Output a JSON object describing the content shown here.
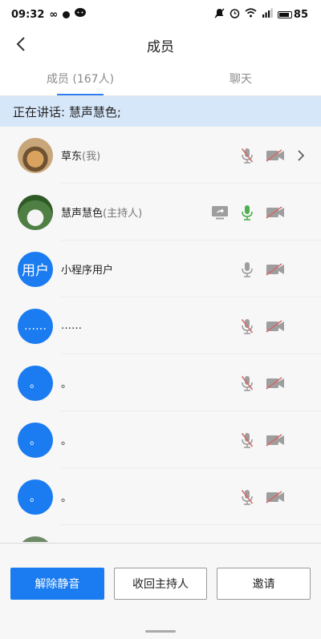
{
  "status_bar": {
    "time": "09:32",
    "infinity": "∞",
    "battery": "85"
  },
  "header": {
    "title": "成员"
  },
  "tabs": [
    {
      "label": "成员 (167人)",
      "active": true
    },
    {
      "label": "聊天",
      "active": false
    }
  ],
  "speaking": {
    "text": "正在讲话: 慧声慧色;"
  },
  "members": [
    {
      "avatar_text": "",
      "avatar_style": "photo1",
      "name": "草东",
      "role": "(我)",
      "share": false,
      "mic": "muted",
      "cam": "off",
      "chevron": true
    },
    {
      "avatar_text": "",
      "avatar_style": "photo2",
      "name": "慧声慧色",
      "role": "(主持人)",
      "share": true,
      "mic": "active",
      "cam": "off",
      "chevron": false
    },
    {
      "avatar_text": "用户",
      "avatar_style": "blue",
      "name": "小程序用户",
      "role": "",
      "share": false,
      "mic": "normal",
      "cam": "off",
      "chevron": false
    },
    {
      "avatar_text": "……",
      "avatar_style": "blue",
      "name": "……",
      "role": "",
      "share": false,
      "mic": "muted",
      "cam": "off",
      "chevron": false
    },
    {
      "avatar_text": "。",
      "avatar_style": "blue",
      "name": "。",
      "role": "",
      "share": false,
      "mic": "muted",
      "cam": "off",
      "chevron": false
    },
    {
      "avatar_text": "。",
      "avatar_style": "blue",
      "name": "。",
      "role": "",
      "share": false,
      "mic": "muted",
      "cam": "off",
      "chevron": false
    },
    {
      "avatar_text": "。",
      "avatar_style": "blue",
      "name": "。",
      "role": "",
      "share": false,
      "mic": "muted",
      "cam": "off",
      "chevron": false
    },
    {
      "avatar_text": "",
      "avatar_style": "photo3",
      "name": "",
      "role": "",
      "share": false,
      "mic": "none",
      "cam": "none",
      "chevron": false
    }
  ],
  "buttons": {
    "unmute": "解除静音",
    "reclaim_host": "收回主持人",
    "invite": "邀请"
  },
  "colors": {
    "accent": "#1a7cf0",
    "mic_active": "#4caf50",
    "muted": "#d46a6a",
    "icon_gray": "#9e9e9e"
  }
}
